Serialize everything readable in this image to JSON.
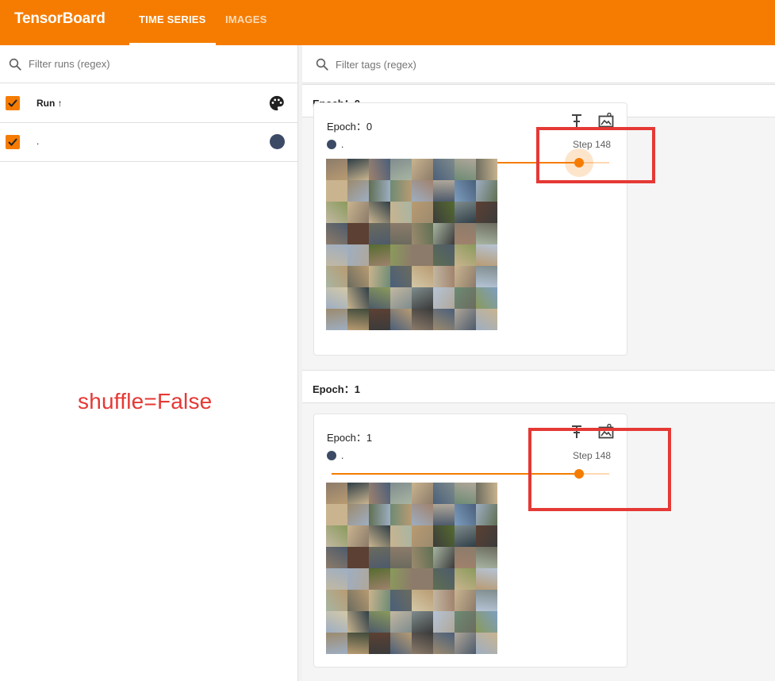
{
  "app": {
    "title": "TensorBoard"
  },
  "tabs": [
    {
      "label": "TIME SERIES",
      "active": true
    },
    {
      "label": "IMAGES",
      "active": false
    }
  ],
  "sidebar": {
    "filter_placeholder": "Filter runs (regex)",
    "header_label": "Run ↑",
    "runs": [
      {
        "name": ".",
        "color": "#3c4a66",
        "checked": true
      }
    ]
  },
  "main": {
    "filter_placeholder": "Filter tags (regex)",
    "groups": [
      {
        "header": "Epoch：0",
        "card": {
          "title": "Epoch：0",
          "run": ".",
          "step_label": "Step 148",
          "slider_value_fraction": 0.89
        }
      },
      {
        "header": "Epoch：1",
        "card": {
          "title": "Epoch：1",
          "run": ".",
          "step_label": "Step 148",
          "slider_value_fraction": 0.89
        }
      }
    ]
  },
  "annotation": {
    "text": "shuffle=False",
    "color": "#e53935"
  },
  "colors": {
    "accent": "#f57c00",
    "run_color": "#3c4a66",
    "annotation_box": "#e53935"
  }
}
